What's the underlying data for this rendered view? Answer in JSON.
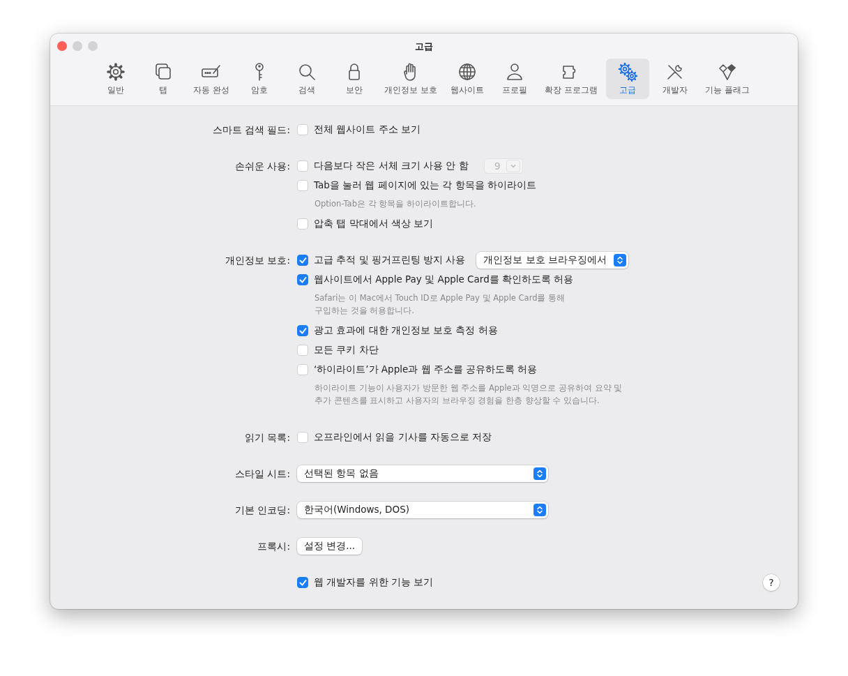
{
  "window": {
    "title": "고급"
  },
  "toolbar": [
    {
      "label": "일반",
      "selected": false
    },
    {
      "label": "탭",
      "selected": false
    },
    {
      "label": "자동 완성",
      "selected": false
    },
    {
      "label": "암호",
      "selected": false
    },
    {
      "label": "검색",
      "selected": false
    },
    {
      "label": "보안",
      "selected": false
    },
    {
      "label": "개인정보 보호",
      "selected": false
    },
    {
      "label": "웹사이트",
      "selected": false
    },
    {
      "label": "프로필",
      "selected": false
    },
    {
      "label": "확장 프로그램",
      "selected": false
    },
    {
      "label": "고급",
      "selected": true
    },
    {
      "label": "개발자",
      "selected": false
    },
    {
      "label": "기능 플래그",
      "selected": false
    }
  ],
  "sections": [
    {
      "label": "스마트 검색 필드:",
      "items": [
        {
          "kind": "checkbox",
          "label": "전체 웹사이트 주소 보기",
          "checked": false
        }
      ]
    },
    {
      "label": "손쉬운 사용:",
      "items": [
        {
          "kind": "checkbox",
          "label": "다음보다 작은 서체 크기 사용 안 함",
          "checked": false,
          "stepper": {
            "value": "9",
            "disabled": true
          }
        },
        {
          "kind": "checkbox",
          "label": "Tab을 눌러 웹 페이지에 있는 각 항목을 하이라이트",
          "checked": false
        },
        {
          "kind": "note",
          "text": "Option-Tab은 각 항목을 하이라이트합니다."
        },
        {
          "kind": "checkbox",
          "label": "압축 탭 막대에서 색상 보기",
          "checked": false
        }
      ]
    },
    {
      "label": "개인정보 보호:",
      "items": [
        {
          "kind": "checkbox",
          "label": "고급 추적 및 핑거프린팅 방지 사용",
          "checked": true,
          "popup": "개인정보 보호 브라우징에서"
        },
        {
          "kind": "checkbox",
          "label": "웹사이트에서 Apple Pay 및 Apple Card를 확인하도록 허용",
          "checked": true
        },
        {
          "kind": "note",
          "text": "Safari는 이 Mac에서 Touch ID로 Apple Pay 및 Apple Card를 통해\n구입하는 것을 허용합니다."
        },
        {
          "kind": "checkbox",
          "label": "광고 효과에 대한 개인정보 보호 측정 허용",
          "checked": true
        },
        {
          "kind": "checkbox",
          "label": "모든 쿠키 차단",
          "checked": false
        },
        {
          "kind": "checkbox",
          "label": "‘하이라이트’가 Apple과 웹 주소를 공유하도록 허용",
          "checked": false
        },
        {
          "kind": "note",
          "text": "하이라이트 기능이 사용자가 방문한 웹 주소를 Apple과 익명으로 공유하여 요약 및\n추가 콘텐츠를 표시하고 사용자의 브라우징 경험을 한층 향상할 수 있습니다."
        }
      ]
    },
    {
      "label": "읽기 목록:",
      "items": [
        {
          "kind": "checkbox",
          "label": "오프라인에서 읽을 기사를 자동으로 저장",
          "checked": false
        }
      ]
    },
    {
      "label": "스타일 시트:",
      "items": [
        {
          "kind": "select",
          "value": "선택된 항목 없음"
        }
      ]
    },
    {
      "label": "기본 인코딩:",
      "items": [
        {
          "kind": "select",
          "value": "한국어(Windows, DOS)"
        }
      ]
    },
    {
      "label": "프록시:",
      "items": [
        {
          "kind": "button",
          "label": "설정 변경..."
        }
      ]
    },
    {
      "items": [
        {
          "kind": "checkbox",
          "label": "웹 개발자를 위한 기능 보기",
          "checked": true
        }
      ]
    }
  ],
  "help_button": "?"
}
